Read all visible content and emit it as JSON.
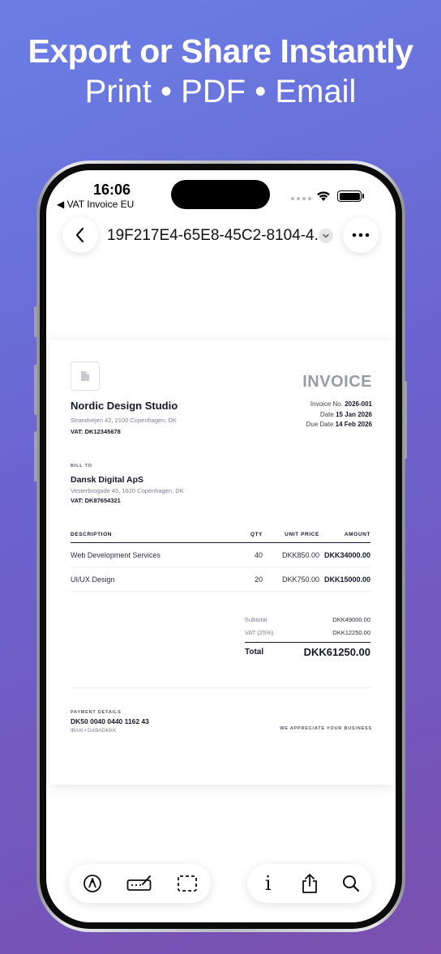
{
  "headline": {
    "title": "Export or Share Instantly",
    "subtitle": "Print • PDF • Email"
  },
  "status_bar": {
    "time": "16:06",
    "back_app": "◀ VAT Invoice EU"
  },
  "nav": {
    "document_title": "19F217E4-65E8-45C2-8104-4...",
    "back_icon": "chevron-left-icon",
    "more_icon": "ellipsis-icon"
  },
  "invoice": {
    "title": "INVOICE",
    "company": {
      "name": "Nordic Design Studio",
      "address": "Strandvejen 42, 2100 Copenhagen, DK",
      "vat": "VAT: DK12345678"
    },
    "meta": {
      "number_label": "Invoice No.",
      "number": "2026-001",
      "date_label": "Date",
      "date": "15 Jan 2026",
      "due_label": "Due Date",
      "due": "14 Feb 2026"
    },
    "bill_to": {
      "label": "BILL TO",
      "name": "Dansk Digital ApS",
      "address": "Vesterbrogade 45, 1620 Copenhagen, DK",
      "vat": "VAT: DK87654321"
    },
    "columns": [
      "DESCRIPTION",
      "QTY",
      "UNIT PRICE",
      "AMOUNT"
    ],
    "items": [
      {
        "description": "Web Development Services",
        "qty": "40",
        "unit_price": "DKK850.00",
        "amount": "DKK34000.00"
      },
      {
        "description": "UI/UX Design",
        "qty": "20",
        "unit_price": "DKK750.00",
        "amount": "DKK15000.00"
      }
    ],
    "totals": {
      "subtotal_label": "Subtotal",
      "subtotal": "DKK49000.00",
      "vat_label": "VAT (25%)",
      "vat": "DKK12250.00",
      "total_label": "Total",
      "total": "DKK61250.00"
    },
    "payment": {
      "label": "PAYMENT DETAILS",
      "iban": "DK50 0040 0440 1162 43",
      "sub": "IBAN • DABADKKK"
    },
    "thanks": "WE APPRECIATE YOUR BUSINESS"
  },
  "toolbar": {
    "left_icons": [
      "markup-pen-icon",
      "signature-icon",
      "selection-icon"
    ],
    "right_icons": [
      "info-icon",
      "share-icon",
      "search-icon"
    ],
    "info_glyph": "i"
  }
}
